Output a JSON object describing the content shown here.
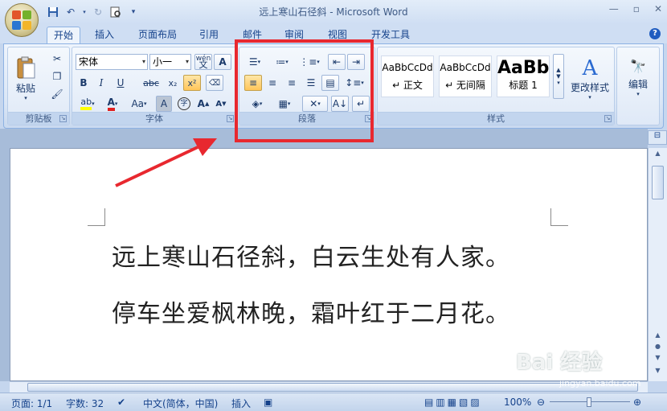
{
  "window": {
    "title": "远上寒山石径斜 - Microsoft Word",
    "controls": [
      "minimize-icon",
      "maximize-icon",
      "close-icon"
    ]
  },
  "quick_access": [
    "save-icon",
    "undo-icon",
    "redo-icon",
    "print-preview-icon",
    "customize-icon"
  ],
  "tabs": [
    {
      "label": "开始",
      "active": true
    },
    {
      "label": "插入"
    },
    {
      "label": "页面布局"
    },
    {
      "label": "引用"
    },
    {
      "label": "邮件"
    },
    {
      "label": "审阅"
    },
    {
      "label": "视图"
    },
    {
      "label": "开发工具"
    }
  ],
  "ribbon": {
    "clipboard": {
      "label": "剪贴板",
      "paste_label": "粘贴"
    },
    "font": {
      "label": "字体",
      "font_name": "宋体",
      "font_size": "小一",
      "wen_label": "wén",
      "bold": "B",
      "italic": "I",
      "underline": "U",
      "strike": "abc",
      "sub": "x₂",
      "sup": "x²",
      "grow": "A",
      "shrink": "A",
      "case_label": "Aa",
      "border_char": "A",
      "circle_char": "字"
    },
    "paragraph": {
      "label": "段落"
    },
    "styles": {
      "label": "样式",
      "items": [
        {
          "sample": "AaBbCcDd",
          "name": "↵ 正文"
        },
        {
          "sample": "AaBbCcDd",
          "name": "↵ 无间隔"
        },
        {
          "sample": "AaBb",
          "name": "标题 1"
        }
      ],
      "change_label": "更改样式"
    },
    "editing": {
      "label": "编辑"
    }
  },
  "document": {
    "lines": [
      "远上寒山石径斜，白云生处有人家。",
      "停车坐爱枫林晚，霜叶红于二月花。"
    ]
  },
  "status": {
    "page": "页面: 1/1",
    "words": "字数: 32",
    "language": "中文(简体，中国)",
    "mode": "插入",
    "zoom": "100%"
  },
  "watermark": {
    "text": "Bai 经验",
    "url": "jingyan.baidu.com"
  },
  "colors": {
    "highlight": "#e8282f",
    "ribbon": "#dae6f6",
    "accent": "#15428b"
  }
}
